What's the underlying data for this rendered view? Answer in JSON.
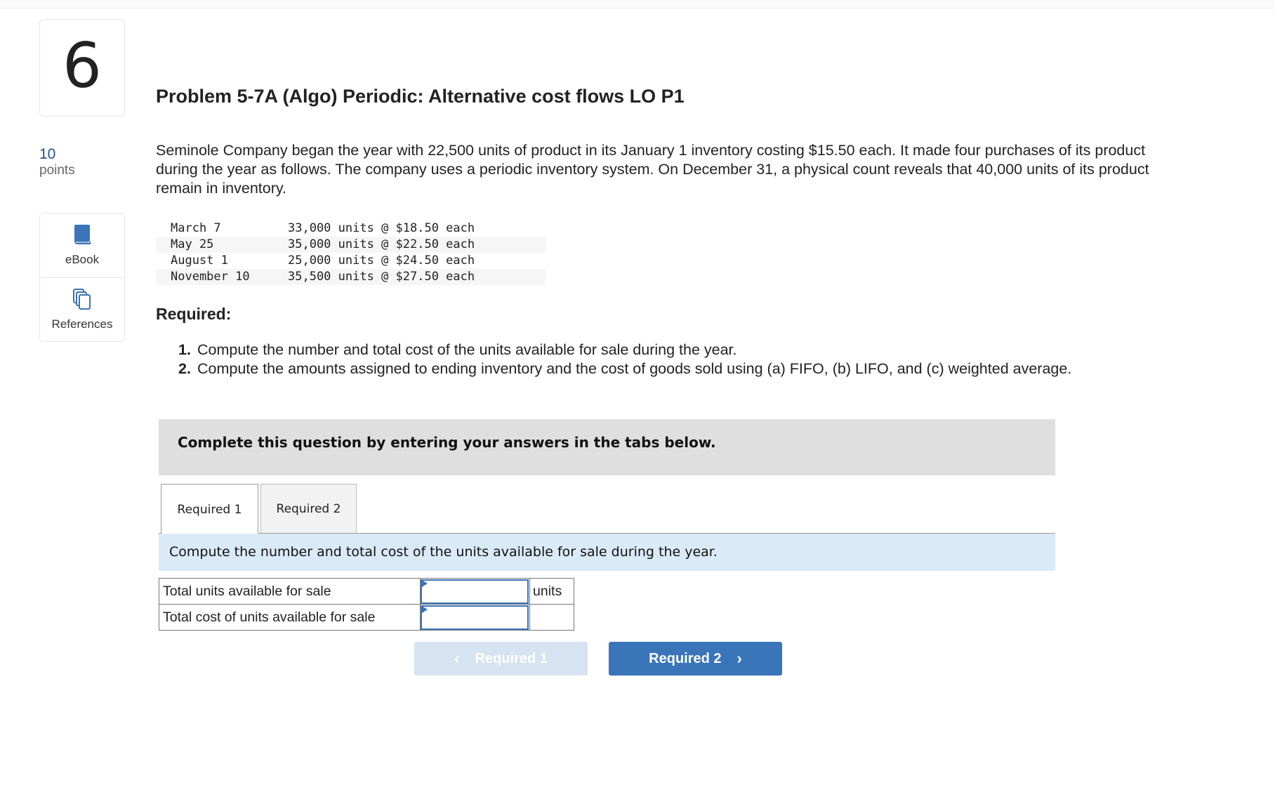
{
  "question": {
    "number": "6",
    "points_value": "10",
    "points_label": "points"
  },
  "tools": [
    {
      "label": "eBook",
      "icon": "book-icon"
    },
    {
      "label": "References",
      "icon": "copy-pages-icon"
    }
  ],
  "problem": {
    "title": "Problem 5-7A (Algo) Periodic: Alternative cost flows LO P1",
    "intro": "Seminole Company began the year with 22,500 units of product in its January 1 inventory costing $15.50 each. It made four purchases of its product during the year as follows. The company uses a periodic inventory system. On December 31, a physical count reveals that 40,000 units of its product remain in inventory.",
    "purchases": [
      {
        "date": "March 7",
        "detail": "33,000 units @ $18.50 each"
      },
      {
        "date": "May 25",
        "detail": "35,000 units @ $22.50 each"
      },
      {
        "date": "August 1",
        "detail": "25,000 units @ $24.50 each"
      },
      {
        "date": "November 10",
        "detail": "35,500 units @ $27.50 each"
      }
    ],
    "required_heading": "Required:",
    "required_items": [
      {
        "num": "1.",
        "text": "Compute the number and total cost of the units available for sale during the year."
      },
      {
        "num": "2.",
        "text": "Compute the amounts assigned to ending inventory and the cost of goods sold using (a) FIFO, (b) LIFO, and (c) weighted average."
      }
    ]
  },
  "answer_area": {
    "instruction_banner": "Complete this question by entering your answers in the tabs below.",
    "tabs": [
      {
        "label": "Required 1",
        "active": true
      },
      {
        "label": "Required 2",
        "active": false
      }
    ],
    "tab_instruction": "Compute the number and total cost of the units available for sale during the year.",
    "rows": [
      {
        "label": "Total units available for sale",
        "value": "",
        "unit": "units"
      },
      {
        "label": "Total cost of units available for sale",
        "value": "",
        "unit": ""
      }
    ],
    "prev_button": "Required 1",
    "next_button": "Required 2"
  },
  "colors": {
    "accent": "#3a75ba",
    "disabled_button": "#d6e3f1",
    "banner_gray": "#dfdfdf",
    "instruction_blue": "#daeaf8"
  }
}
